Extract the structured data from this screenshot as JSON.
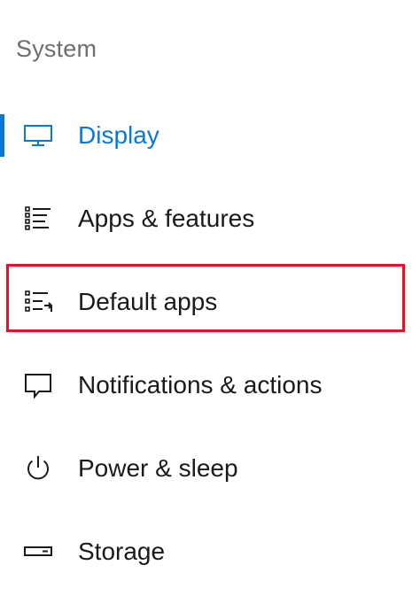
{
  "section": {
    "title": "System"
  },
  "nav": {
    "items": [
      {
        "label": "Display",
        "icon": "monitor-icon",
        "selected": true
      },
      {
        "label": "Apps & features",
        "icon": "list-icon",
        "selected": false
      },
      {
        "label": "Default apps",
        "icon": "list-arrow-icon",
        "selected": false
      },
      {
        "label": "Notifications & actions",
        "icon": "speech-bubble-icon",
        "selected": false
      },
      {
        "label": "Power & sleep",
        "icon": "power-icon",
        "selected": false
      },
      {
        "label": "Storage",
        "icon": "storage-drive-icon",
        "selected": false
      }
    ]
  },
  "colors": {
    "accent": "#0a78d7",
    "highlight_border": "#e81123",
    "section_title": "#6e6e6e",
    "text": "#1a1a1a"
  }
}
